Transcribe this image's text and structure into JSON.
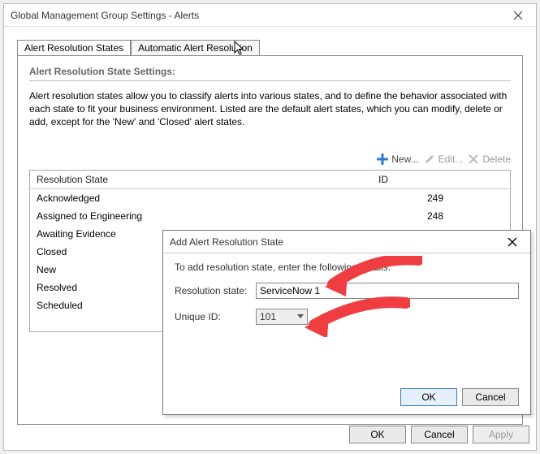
{
  "window": {
    "title": "Global Management Group Settings - Alerts"
  },
  "tabs": {
    "active": "Alert Resolution States",
    "inactive": "Automatic Alert Resolution"
  },
  "section": {
    "heading": "Alert Resolution State Settings:",
    "description": "Alert resolution states allow you to classify alerts into various states, and to define the behavior associated with each state to fit your business environment. Listed are the default alert states, which you can modify, delete or add, except for the 'New' and 'Closed' alert states."
  },
  "toolbar": {
    "new": "New...",
    "edit": "Edit...",
    "delete": "Delete"
  },
  "grid": {
    "header": {
      "col1": "Resolution State",
      "col2": "ID"
    },
    "rows": [
      {
        "name": "Acknowledged",
        "id": "249"
      },
      {
        "name": "Assigned to Engineering",
        "id": "248"
      },
      {
        "name": "Awaiting Evidence",
        "id": ""
      },
      {
        "name": "Closed",
        "id": ""
      },
      {
        "name": "New",
        "id": ""
      },
      {
        "name": "Resolved",
        "id": ""
      },
      {
        "name": "Scheduled",
        "id": ""
      }
    ]
  },
  "dialog": {
    "title": "Add Alert Resolution State",
    "prompt": "To add resolution state, enter the following details:",
    "label_state": "Resolution state:",
    "value_state": "ServiceNow 1",
    "label_id": "Unique ID:",
    "value_id": "101",
    "ok": "OK",
    "cancel": "Cancel"
  },
  "footer": {
    "ok": "OK",
    "cancel": "Cancel",
    "apply": "Apply"
  }
}
